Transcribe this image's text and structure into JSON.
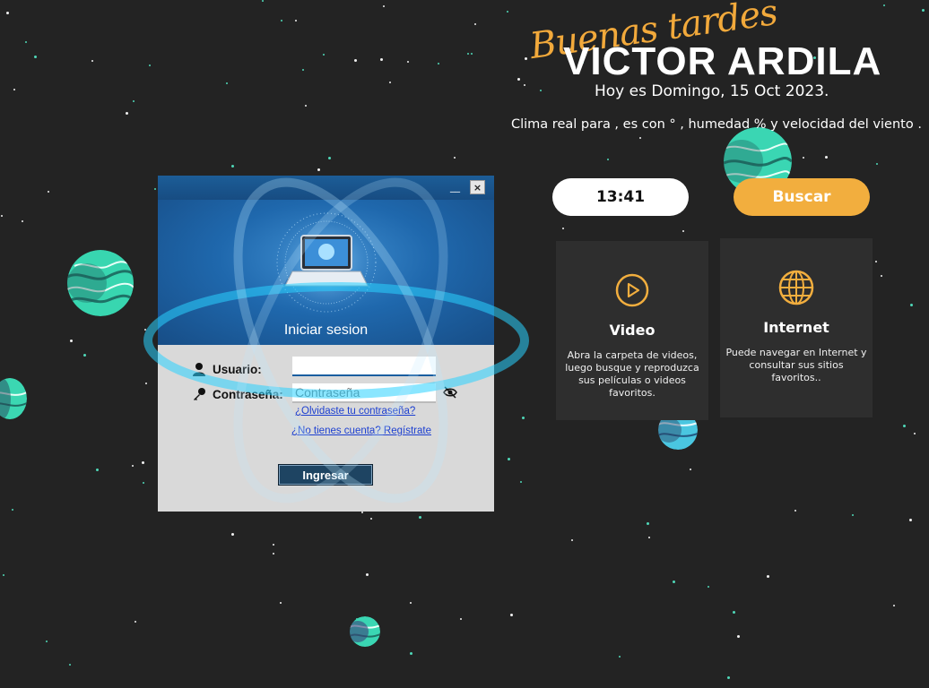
{
  "greeting": {
    "script_text": "Buenas tardes",
    "user_name": "VICTOR ARDILA",
    "date_line": "Hoy es Domingo, 15 Oct 2023.",
    "weather_line": "Clima real para , es  con ° , humedad % y velocidad del viento  ."
  },
  "clock": {
    "time": "13:41"
  },
  "search": {
    "label": "Buscar"
  },
  "cards": [
    {
      "title": "Video",
      "description": "Abra la carpeta de videos, luego busque y reproduzca sus películas o videos favoritos.",
      "icon": "play-circle-icon"
    },
    {
      "title": "Internet",
      "description": "Puede navegar en Internet y consultar sus sitios favoritos..",
      "icon": "globe-icon"
    }
  ],
  "login": {
    "minimize_label": "__",
    "close_label": "×",
    "title": "Iniciar sesion",
    "username_label": "Usuario:",
    "username_value": "",
    "password_label": "Contraseña:",
    "password_placeholder": "Contraseña",
    "forgot_link": "¿Olvidaste tu contraseña?",
    "register_link": "¿No tienes cuenta? Regístrate",
    "submit_label": "Ingresar"
  },
  "colors": {
    "background": "#232323",
    "accent_orange": "#f2ae3e",
    "accent_teal": "#4fd8b8",
    "card_bg": "#2e2e2e",
    "login_blue": "#1f68ad"
  }
}
